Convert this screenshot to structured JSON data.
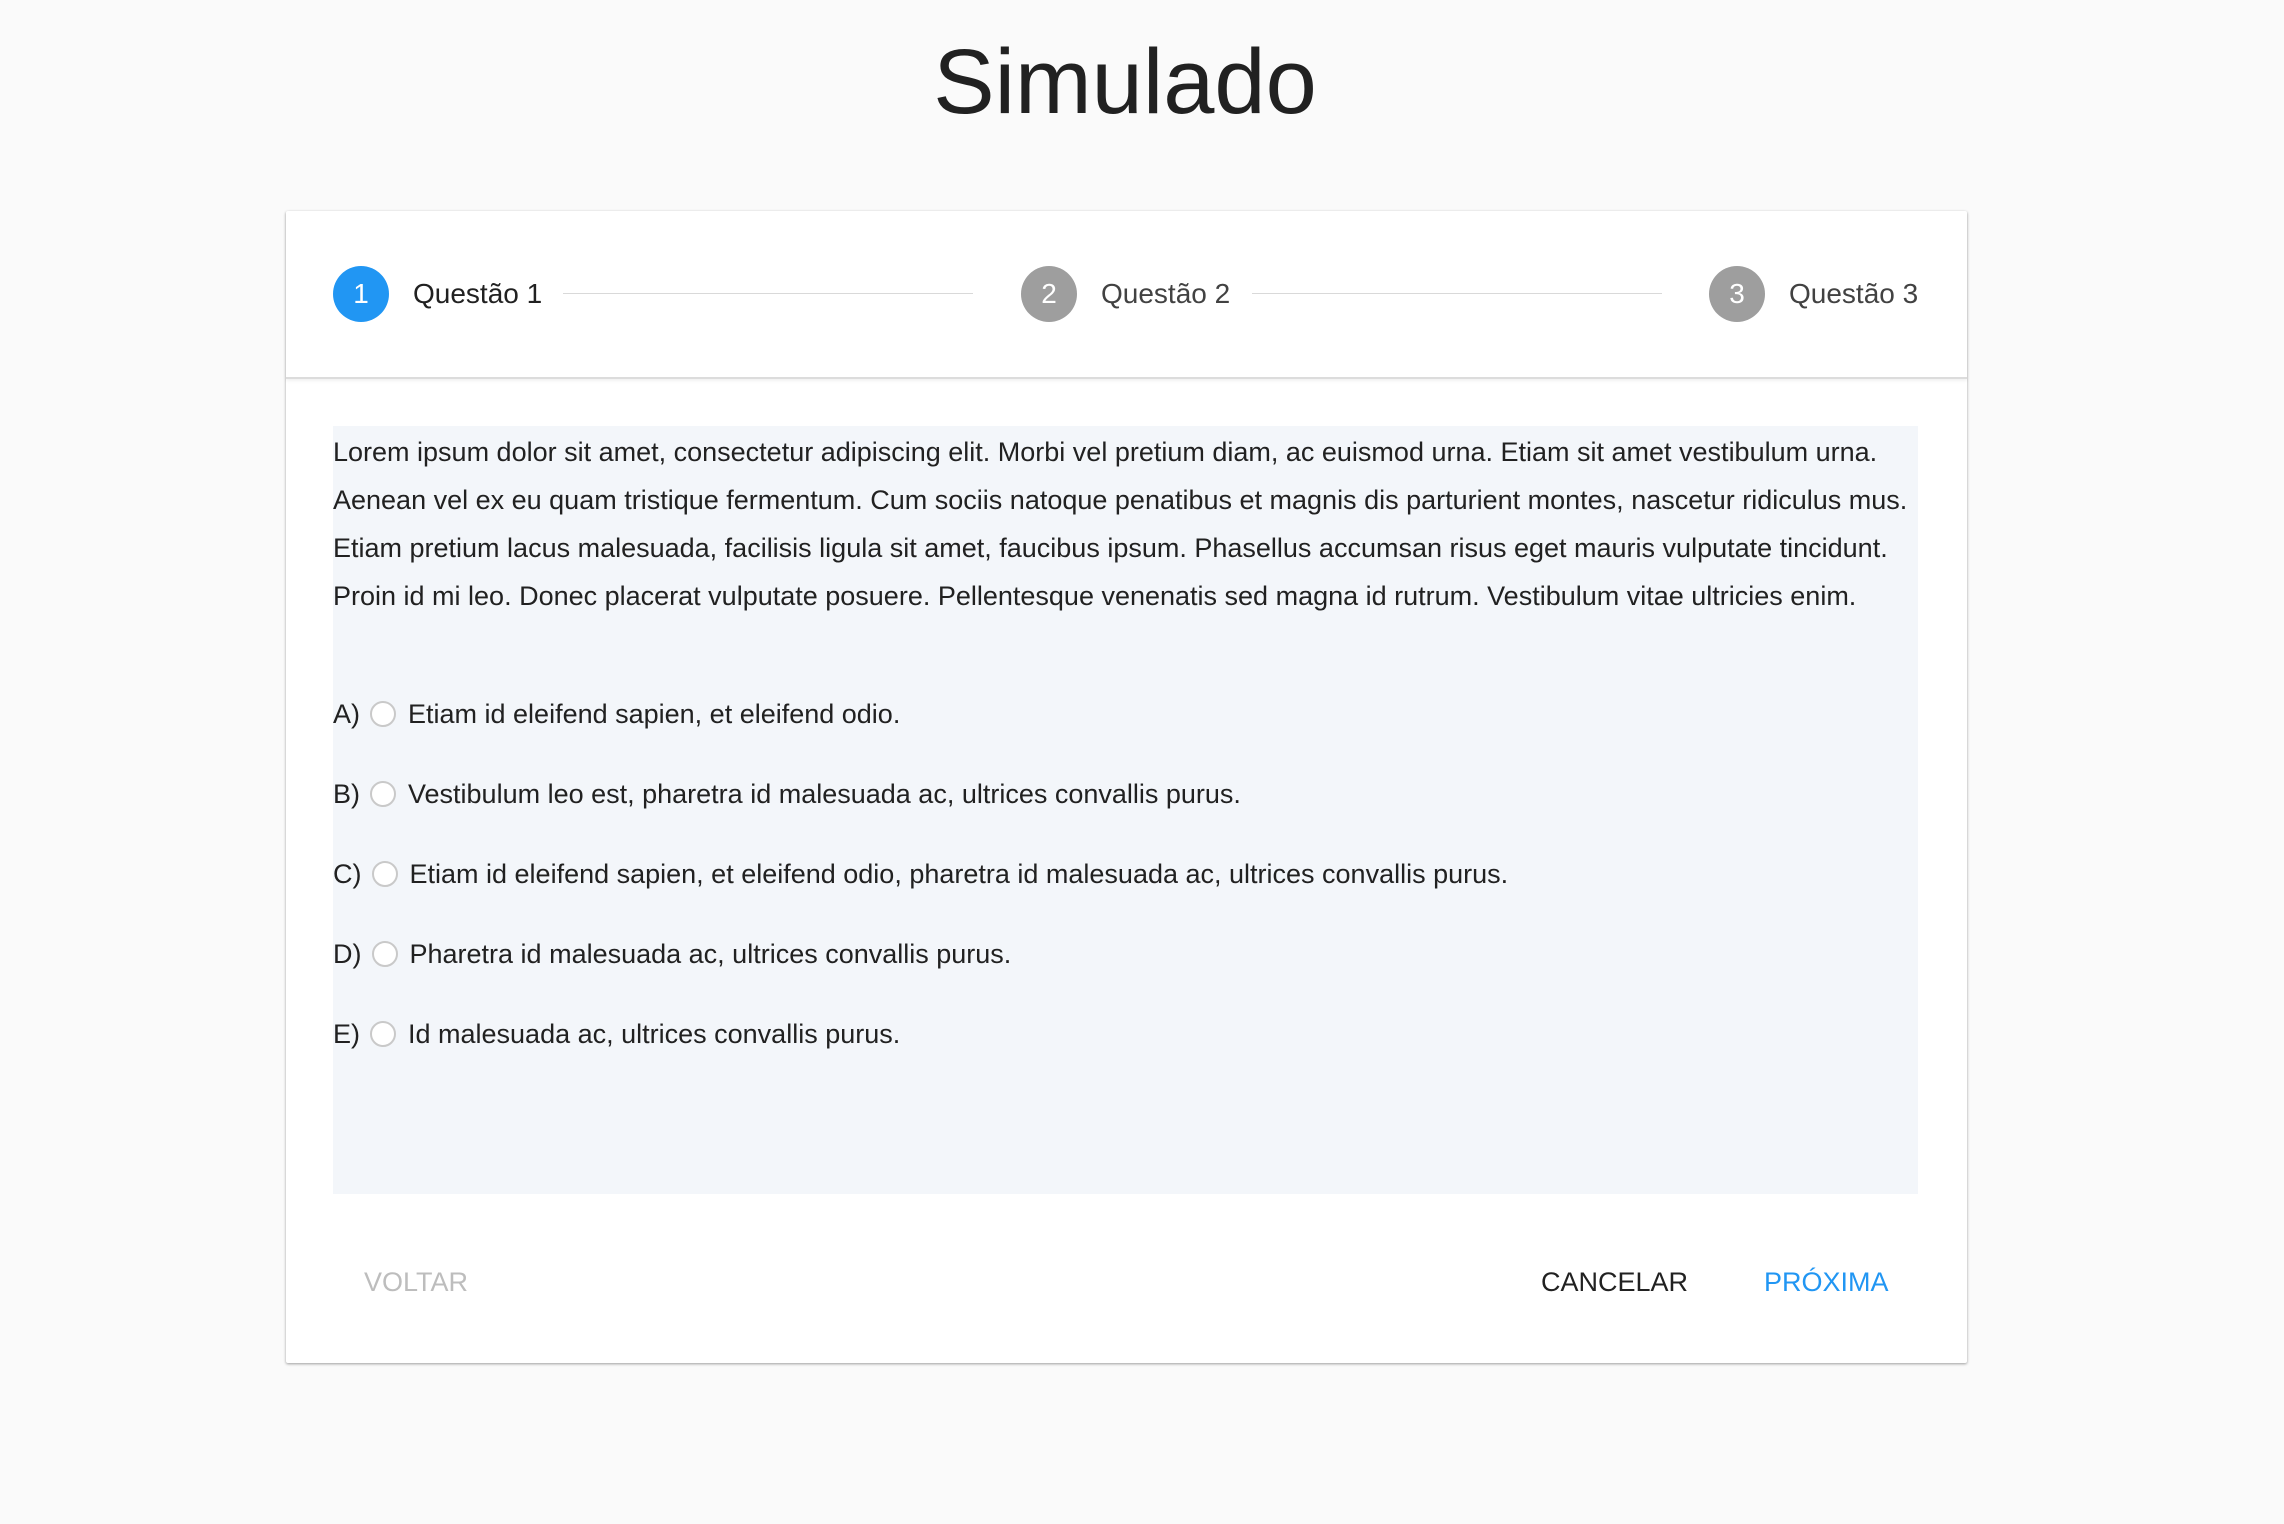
{
  "page": {
    "title": "Simulado"
  },
  "stepper": {
    "steps": [
      {
        "number": "1",
        "label": "Questão 1",
        "state": "active"
      },
      {
        "number": "2",
        "label": "Questão 2",
        "state": "inactive"
      },
      {
        "number": "3",
        "label": "Questão 3",
        "state": "inactive"
      }
    ]
  },
  "question": {
    "text": "Lorem ipsum dolor sit amet, consectetur adipiscing elit. Morbi vel pretium diam, ac euismod urna. Etiam sit amet vestibulum urna. Aenean vel ex eu quam tristique fermentum. Cum sociis natoque penatibus et magnis dis parturient montes, nascetur ridiculus mus. Etiam pretium lacus malesuada, facilisis ligula sit amet, faucibus ipsum. Phasellus accumsan risus eget mauris vulputate tincidunt. Proin id mi leo. Donec placerat vulputate posuere. Pellentesque venenatis sed magna id rutrum. Vestibulum vitae ultricies enim.",
    "options": [
      {
        "letter": "A)",
        "text": "Etiam id eleifend sapien, et eleifend odio.",
        "selected": false
      },
      {
        "letter": "B)",
        "text": "Vestibulum leo est, pharetra id malesuada ac, ultrices convallis purus.",
        "selected": false
      },
      {
        "letter": "C)",
        "text": "Etiam id eleifend sapien, et eleifend odio, pharetra id malesuada ac, ultrices convallis purus.",
        "selected": false
      },
      {
        "letter": "D)",
        "text": "Pharetra id malesuada ac, ultrices convallis purus.",
        "selected": false
      },
      {
        "letter": "E)",
        "text": "Id malesuada ac, ultrices convallis purus.",
        "selected": false
      }
    ]
  },
  "actions": {
    "back_label": "VOLTAR",
    "cancel_label": "CANCELAR",
    "next_label": "PRÓXIMA"
  },
  "colors": {
    "primary": "#2196f3",
    "inactive_step": "#9e9e9e",
    "disabled_text": "#bdbdbd",
    "content_background": "#f3f6fa",
    "page_background": "#fafafa"
  }
}
